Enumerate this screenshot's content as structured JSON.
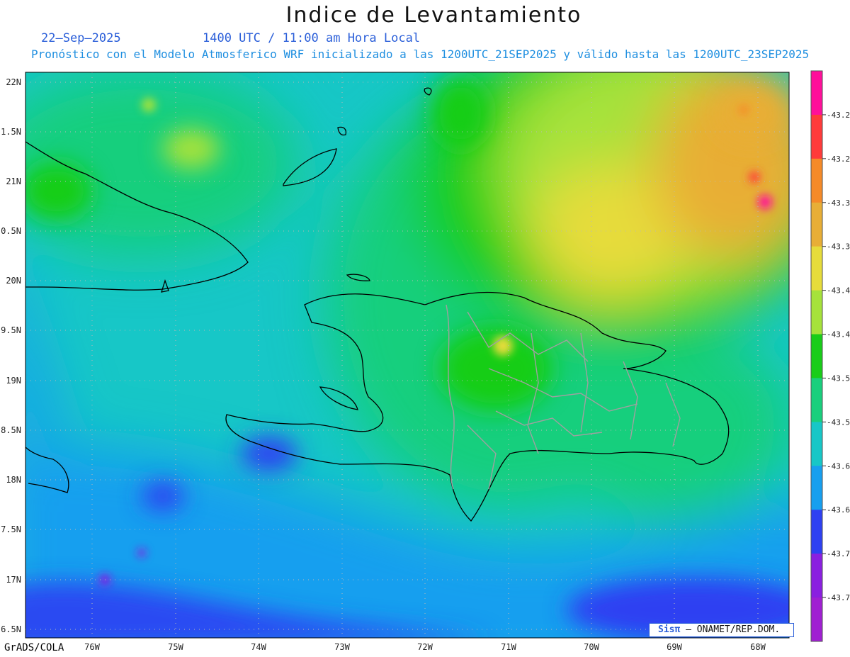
{
  "header": {
    "title": "Indice de Levantamiento",
    "date": "22–Sep–2025",
    "time": "1400 UTC / 11:00 am Hora Local",
    "subtitle": "Pronóstico con el Modelo Atmosferico WRF inicializado a las 1200UTC_21SEP2025 y válido hasta las  1200UTC_23SEP2025"
  },
  "axes": {
    "lat_labels": [
      "22N",
      "1.5N",
      "21N",
      "0.5N",
      "20N",
      "9.5N",
      "19N",
      "8.5N",
      "18N",
      "7.5N",
      "17N",
      "6.5N"
    ],
    "lon_labels": [
      "76W",
      "75W",
      "74W",
      "73W",
      "72W",
      "71W",
      "70W",
      "69W",
      "68W"
    ]
  },
  "colorbar": {
    "labels": [
      "-43.2",
      "-43.2",
      "-43.3",
      "-43.3",
      "-43.4",
      "-43.4",
      "-43.5",
      "-43.5",
      "-43.6",
      "-43.6",
      "-43.7",
      "-43.7"
    ],
    "colors": [
      "#ff0f9a",
      "#ff3a3a",
      "#f58a28",
      "#e8ae36",
      "#e6dc3a",
      "#a6e23a",
      "#19cd19",
      "#19cf7d",
      "#17c7c7",
      "#179fef",
      "#2e40f2",
      "#8a1fe0",
      "#a01fd2"
    ]
  },
  "footer": {
    "software": "GrADS/COLA",
    "credit_logo": "Sisπ",
    "credit_text": "– ONAMET/REP.DOM."
  },
  "palette": {
    "coast": "#000000",
    "provinces": "#a0a0a0",
    "grid": "#b8b8b8"
  }
}
